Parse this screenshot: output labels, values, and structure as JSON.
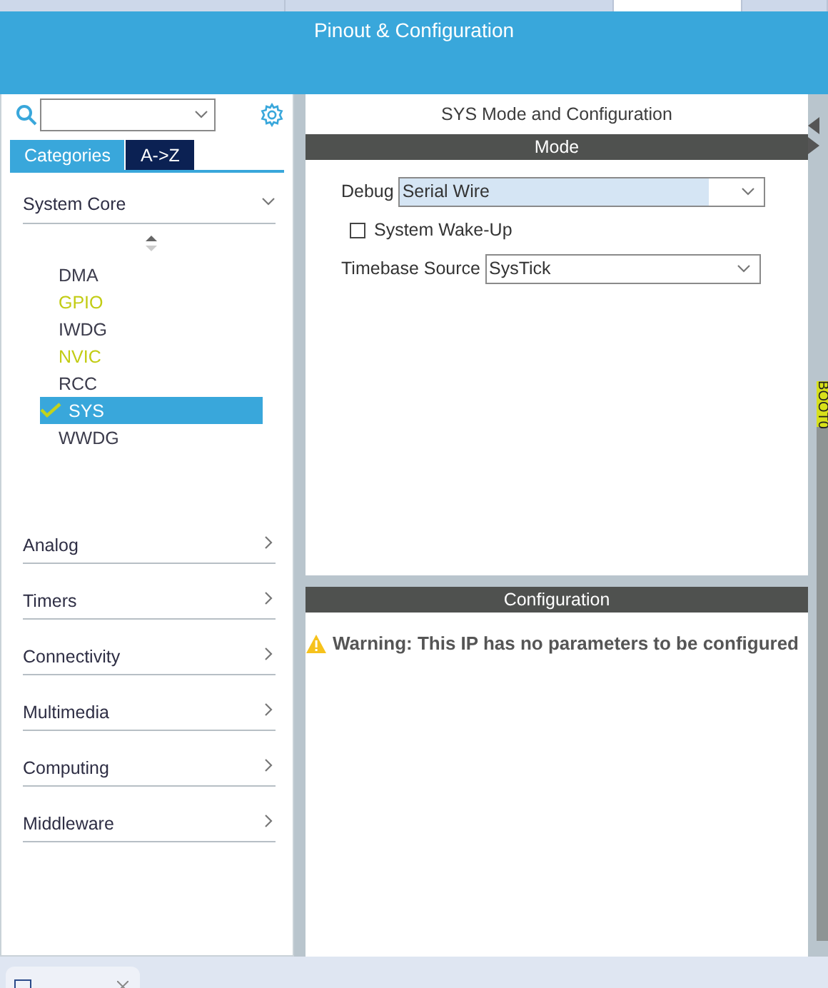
{
  "editor_tabs": [
    {
      "selected": false
    },
    {
      "selected": false
    },
    {
      "selected": true
    },
    {
      "selected": false
    }
  ],
  "header": {
    "title": "Pinout & Configuration"
  },
  "sidebar": {
    "tabs": [
      {
        "label": "Categories",
        "selected": true
      },
      {
        "label": "A->Z",
        "selected": false
      }
    ],
    "groups": [
      {
        "label": "System Core",
        "expanded": true,
        "items": [
          {
            "label": "DMA",
            "color": "#3c3c4c",
            "checked": false,
            "selected": false
          },
          {
            "label": "GPIO",
            "color": "#c2cc14",
            "checked": false,
            "selected": false
          },
          {
            "label": "IWDG",
            "color": "#3c3c4c",
            "checked": false,
            "selected": false
          },
          {
            "label": "NVIC",
            "color": "#c2cc14",
            "checked": false,
            "selected": false
          },
          {
            "label": "RCC",
            "color": "#3c3c4c",
            "checked": false,
            "selected": false
          },
          {
            "label": "SYS",
            "color": "#ffffff",
            "checked": true,
            "selected": true
          },
          {
            "label": "WWDG",
            "color": "#3c3c4c",
            "checked": false,
            "selected": false
          }
        ]
      },
      {
        "label": "Analog",
        "expanded": false
      },
      {
        "label": "Timers",
        "expanded": false
      },
      {
        "label": "Connectivity",
        "expanded": false
      },
      {
        "label": "Multimedia",
        "expanded": false
      },
      {
        "label": "Computing",
        "expanded": false
      },
      {
        "label": "Middleware",
        "expanded": false
      }
    ]
  },
  "panel": {
    "title": "SYS Mode and Configuration",
    "mode_heading": "Mode",
    "fields": [
      {
        "kind": "select",
        "label": "Debug",
        "value": "Serial Wire",
        "highlighted": true
      },
      {
        "kind": "checkbox",
        "label": "System Wake-Up",
        "checked": false
      },
      {
        "kind": "select",
        "label": "Timebase Source",
        "value": "SysTick",
        "highlighted": false
      }
    ],
    "config_heading": "Configuration",
    "warning": "Warning: This IP has no parameters to be configured"
  },
  "pin_strip": {
    "label": "BOOT0"
  }
}
